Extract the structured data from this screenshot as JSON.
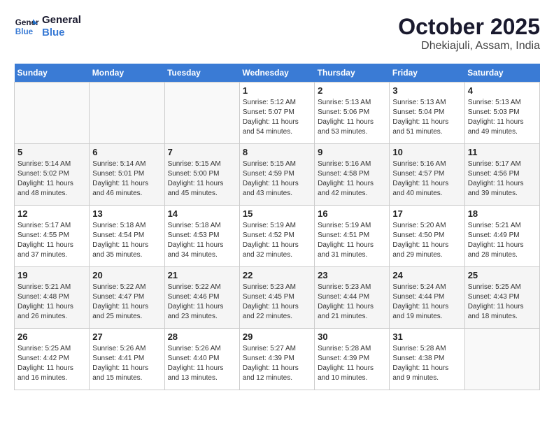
{
  "logo": {
    "line1": "General",
    "line2": "Blue"
  },
  "title": "October 2025",
  "location": "Dhekiajuli, Assam, India",
  "days_of_week": [
    "Sunday",
    "Monday",
    "Tuesday",
    "Wednesday",
    "Thursday",
    "Friday",
    "Saturday"
  ],
  "weeks": [
    [
      {
        "day": "",
        "info": ""
      },
      {
        "day": "",
        "info": ""
      },
      {
        "day": "",
        "info": ""
      },
      {
        "day": "1",
        "info": "Sunrise: 5:12 AM\nSunset: 5:07 PM\nDaylight: 11 hours\nand 54 minutes."
      },
      {
        "day": "2",
        "info": "Sunrise: 5:13 AM\nSunset: 5:06 PM\nDaylight: 11 hours\nand 53 minutes."
      },
      {
        "day": "3",
        "info": "Sunrise: 5:13 AM\nSunset: 5:04 PM\nDaylight: 11 hours\nand 51 minutes."
      },
      {
        "day": "4",
        "info": "Sunrise: 5:13 AM\nSunset: 5:03 PM\nDaylight: 11 hours\nand 49 minutes."
      }
    ],
    [
      {
        "day": "5",
        "info": "Sunrise: 5:14 AM\nSunset: 5:02 PM\nDaylight: 11 hours\nand 48 minutes."
      },
      {
        "day": "6",
        "info": "Sunrise: 5:14 AM\nSunset: 5:01 PM\nDaylight: 11 hours\nand 46 minutes."
      },
      {
        "day": "7",
        "info": "Sunrise: 5:15 AM\nSunset: 5:00 PM\nDaylight: 11 hours\nand 45 minutes."
      },
      {
        "day": "8",
        "info": "Sunrise: 5:15 AM\nSunset: 4:59 PM\nDaylight: 11 hours\nand 43 minutes."
      },
      {
        "day": "9",
        "info": "Sunrise: 5:16 AM\nSunset: 4:58 PM\nDaylight: 11 hours\nand 42 minutes."
      },
      {
        "day": "10",
        "info": "Sunrise: 5:16 AM\nSunset: 4:57 PM\nDaylight: 11 hours\nand 40 minutes."
      },
      {
        "day": "11",
        "info": "Sunrise: 5:17 AM\nSunset: 4:56 PM\nDaylight: 11 hours\nand 39 minutes."
      }
    ],
    [
      {
        "day": "12",
        "info": "Sunrise: 5:17 AM\nSunset: 4:55 PM\nDaylight: 11 hours\nand 37 minutes."
      },
      {
        "day": "13",
        "info": "Sunrise: 5:18 AM\nSunset: 4:54 PM\nDaylight: 11 hours\nand 35 minutes."
      },
      {
        "day": "14",
        "info": "Sunrise: 5:18 AM\nSunset: 4:53 PM\nDaylight: 11 hours\nand 34 minutes."
      },
      {
        "day": "15",
        "info": "Sunrise: 5:19 AM\nSunset: 4:52 PM\nDaylight: 11 hours\nand 32 minutes."
      },
      {
        "day": "16",
        "info": "Sunrise: 5:19 AM\nSunset: 4:51 PM\nDaylight: 11 hours\nand 31 minutes."
      },
      {
        "day": "17",
        "info": "Sunrise: 5:20 AM\nSunset: 4:50 PM\nDaylight: 11 hours\nand 29 minutes."
      },
      {
        "day": "18",
        "info": "Sunrise: 5:21 AM\nSunset: 4:49 PM\nDaylight: 11 hours\nand 28 minutes."
      }
    ],
    [
      {
        "day": "19",
        "info": "Sunrise: 5:21 AM\nSunset: 4:48 PM\nDaylight: 11 hours\nand 26 minutes."
      },
      {
        "day": "20",
        "info": "Sunrise: 5:22 AM\nSunset: 4:47 PM\nDaylight: 11 hours\nand 25 minutes."
      },
      {
        "day": "21",
        "info": "Sunrise: 5:22 AM\nSunset: 4:46 PM\nDaylight: 11 hours\nand 23 minutes."
      },
      {
        "day": "22",
        "info": "Sunrise: 5:23 AM\nSunset: 4:45 PM\nDaylight: 11 hours\nand 22 minutes."
      },
      {
        "day": "23",
        "info": "Sunrise: 5:23 AM\nSunset: 4:44 PM\nDaylight: 11 hours\nand 21 minutes."
      },
      {
        "day": "24",
        "info": "Sunrise: 5:24 AM\nSunset: 4:44 PM\nDaylight: 11 hours\nand 19 minutes."
      },
      {
        "day": "25",
        "info": "Sunrise: 5:25 AM\nSunset: 4:43 PM\nDaylight: 11 hours\nand 18 minutes."
      }
    ],
    [
      {
        "day": "26",
        "info": "Sunrise: 5:25 AM\nSunset: 4:42 PM\nDaylight: 11 hours\nand 16 minutes."
      },
      {
        "day": "27",
        "info": "Sunrise: 5:26 AM\nSunset: 4:41 PM\nDaylight: 11 hours\nand 15 minutes."
      },
      {
        "day": "28",
        "info": "Sunrise: 5:26 AM\nSunset: 4:40 PM\nDaylight: 11 hours\nand 13 minutes."
      },
      {
        "day": "29",
        "info": "Sunrise: 5:27 AM\nSunset: 4:39 PM\nDaylight: 11 hours\nand 12 minutes."
      },
      {
        "day": "30",
        "info": "Sunrise: 5:28 AM\nSunset: 4:39 PM\nDaylight: 11 hours\nand 10 minutes."
      },
      {
        "day": "31",
        "info": "Sunrise: 5:28 AM\nSunset: 4:38 PM\nDaylight: 11 hours\nand 9 minutes."
      },
      {
        "day": "",
        "info": ""
      }
    ]
  ]
}
